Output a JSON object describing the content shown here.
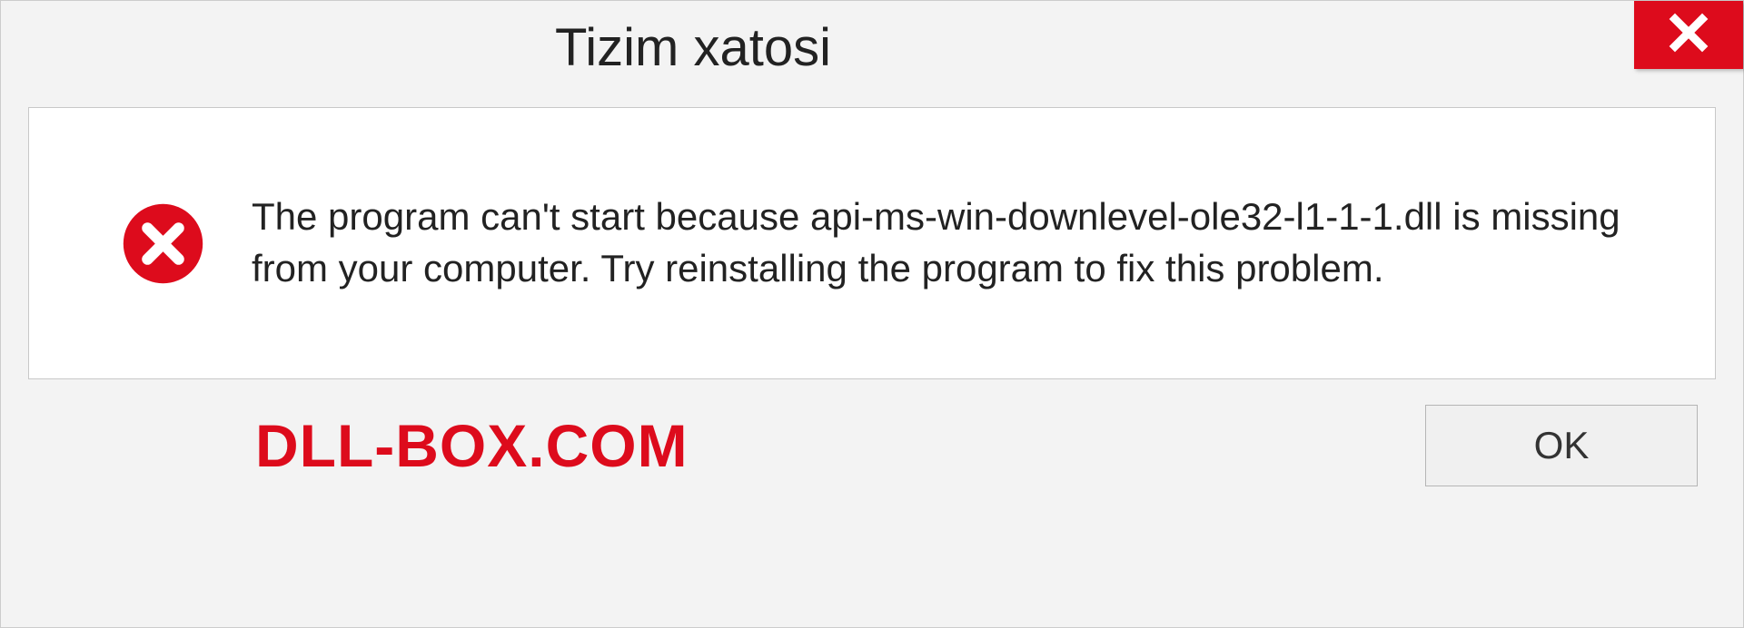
{
  "dialog": {
    "title": "Tizim xatosi",
    "message": "The program can't start because api-ms-win-downlevel-ole32-l1-1-1.dll is missing from your computer. Try reinstalling the program to fix this problem.",
    "ok_label": "OK"
  },
  "watermark": "DLL-BOX.COM",
  "colors": {
    "accent_red": "#dd0b1c"
  }
}
